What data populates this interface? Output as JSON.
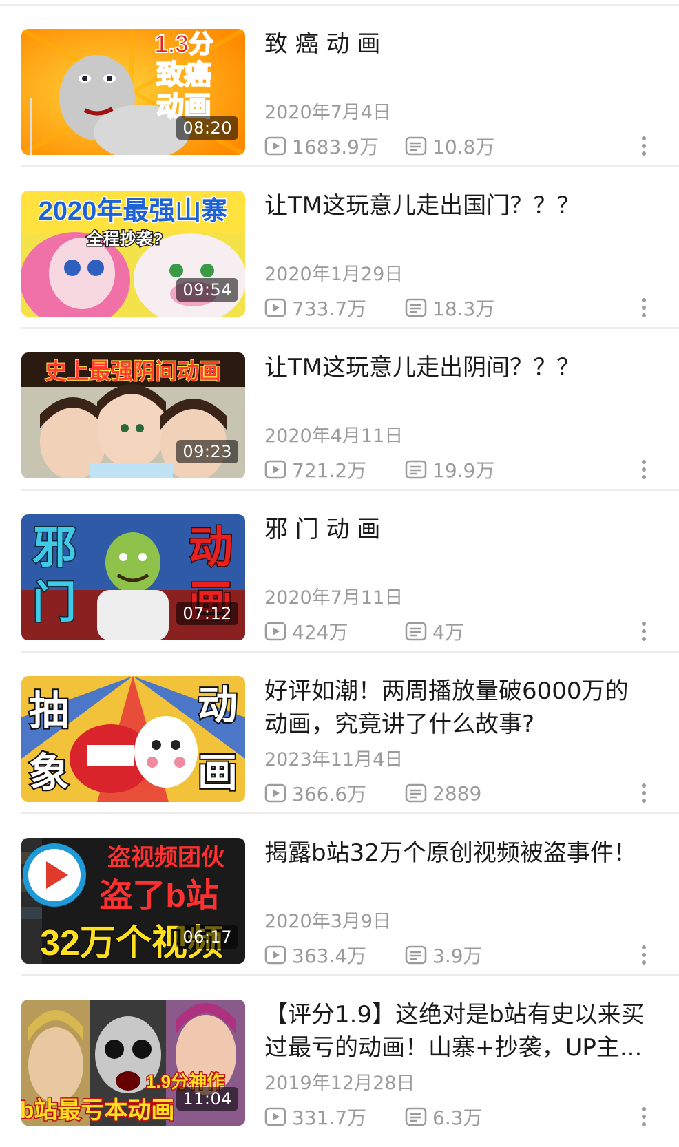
{
  "videos": [
    {
      "title": "致 癌 动 画",
      "duration": "08:20",
      "date": "2020年7月4日",
      "views": "1683.9万",
      "danmaku": "10.8万",
      "thumb_text": [
        "1.3分",
        "致癌",
        "动画"
      ]
    },
    {
      "title": "让TM这玩意儿走出国门？？？",
      "duration": "09:54",
      "date": "2020年1月29日",
      "views": "733.7万",
      "danmaku": "18.3万",
      "thumb_text": [
        "2020年最强山寨",
        "全程抄袭?"
      ]
    },
    {
      "title": "让TM这玩意儿走出阴间？？？",
      "duration": "09:23",
      "date": "2020年4月11日",
      "views": "721.2万",
      "danmaku": "19.9万",
      "thumb_text": [
        "史上最强阴间动画"
      ]
    },
    {
      "title": "邪 门 动 画",
      "duration": "07:12",
      "date": "2020年7月11日",
      "views": "424万",
      "danmaku": "4万",
      "thumb_text": [
        "邪",
        "门",
        "动",
        "画"
      ]
    },
    {
      "title": "好评如潮！两周播放量破6000万的动画，究竟讲了什么故事?",
      "duration": "",
      "date": "2023年11月4日",
      "views": "366.6万",
      "danmaku": "2889",
      "thumb_text": [
        "抽",
        "象",
        "动",
        "画"
      ]
    },
    {
      "title": "揭露b站32万个原创视频被盗事件！",
      "duration": "06:17",
      "date": "2020年3月9日",
      "views": "363.4万",
      "danmaku": "3.9万",
      "thumb_text": [
        "盗视频团伙",
        "盗了b站",
        "32万个视频"
      ]
    },
    {
      "title": "【评分1.9】这绝对是b站有史以来买过最亏的动画！山寨+抄袭，UP主...",
      "duration": "11:04",
      "date": "2019年12月28日",
      "views": "331.7万",
      "danmaku": "6.3万",
      "thumb_text": [
        "1.9分神作",
        "b站最亏本动画"
      ]
    }
  ],
  "colors": {
    "meta_gray": "#9b9b9b",
    "title": "#1a1a1a",
    "divider": "#ececec"
  },
  "icons": {
    "views": "play-count-icon",
    "danmaku": "danmaku-count-icon",
    "more": "more-vertical-icon"
  }
}
